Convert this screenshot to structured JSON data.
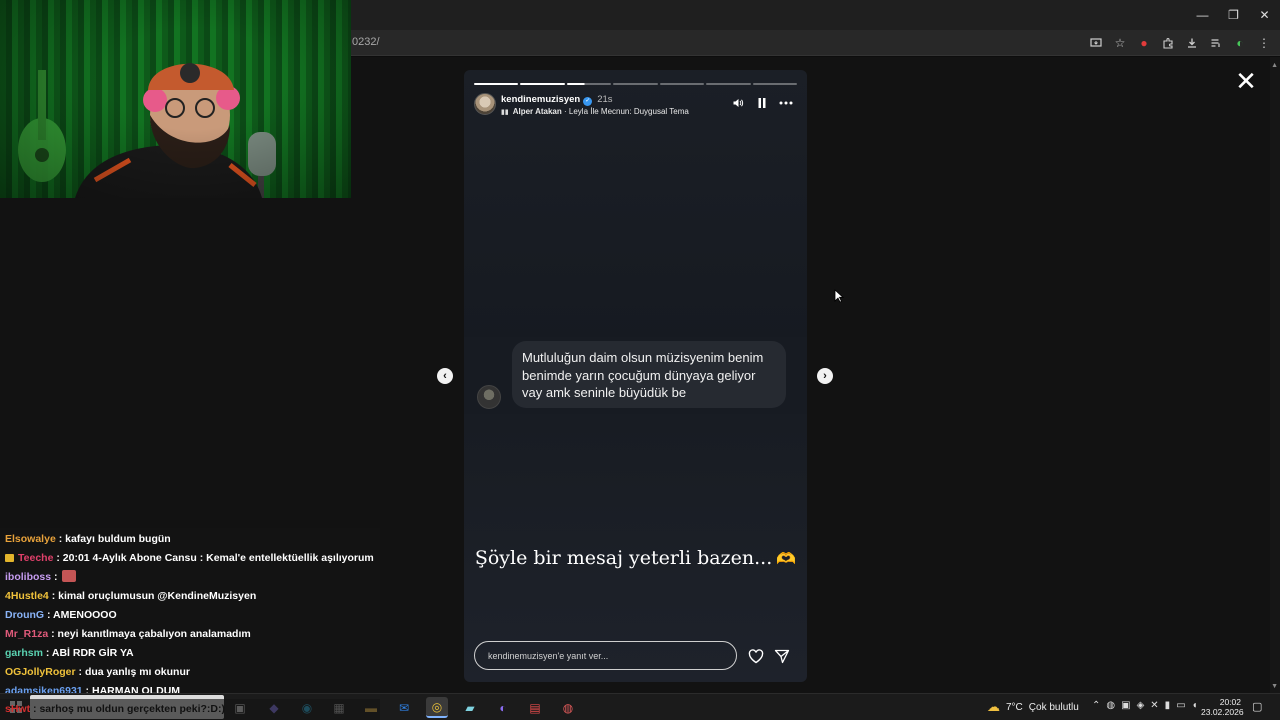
{
  "browser": {
    "url_fragment": "0232/",
    "window_controls": [
      "—",
      "❐",
      "✕"
    ]
  },
  "story": {
    "username": "kendinemuzisyen",
    "time_ago": "21s",
    "music_artist": "Alper Atakan",
    "music_separator": " · ",
    "music_title": "Leyla İle Mecnun: Duygusal Tema",
    "progress": {
      "segments": 7,
      "completed": 2,
      "current_fraction": 0.4
    },
    "comment_text": "Mutluluğun daim olsun müzisyenim benim benimde yarın çocuğum dünyaya geliyor vay amk seninle büyüdük be",
    "caption": "Şöyle bir mesaj yeterli bazen...",
    "caption_emoji": "🫶",
    "reply_placeholder": "kendinemuzisyen'e yanıt ver..."
  },
  "chat": {
    "messages": [
      {
        "user": "Elsowalye",
        "color": "#e8a23b",
        "sep": " : ",
        "text": "kafayı buldum bugün"
      },
      {
        "user": "Teeche",
        "color": "#e0406a",
        "badge": true,
        "sep": " : ",
        "text": "20:01 4-Aylık Abone Cansu : Kemal'e entellektüellik aşılıyorum"
      },
      {
        "user": "iboliboss",
        "color": "#c69cf0",
        "sep": " : ",
        "text": "",
        "emote": true
      },
      {
        "user": "4Hustle4",
        "color": "#f0c23b",
        "sep": " : ",
        "text": "kimal oruçlumusun @KendineMuzisyen"
      },
      {
        "user": "DrounG",
        "color": "#8ab4f8",
        "sep": " : ",
        "text": "AMENOOOO"
      },
      {
        "user": "Mr_R1za",
        "color": "#e05a7a",
        "sep": " : ",
        "text": "neyi kanıtlmaya çabalıyon analamadım"
      },
      {
        "user": "garhsm",
        "color": "#5ad1b0",
        "sep": " : ",
        "text": "ABİ RDR GİR YA"
      },
      {
        "user": "OGJollyRoger",
        "color": "#f0c23b",
        "sep": " : ",
        "text": "dua yanlış mı okunur"
      },
      {
        "user": "adamsiken6931",
        "color": "#6aa0f0",
        "sep": " : ",
        "text": "HARMAN OLDUM"
      }
    ],
    "last_partial": {
      "user": "sHwt",
      "sep": " : ",
      "text": "sarhoş mu oldun gerçekten peki?:D:)"
    }
  },
  "taskbar": {
    "weather_temp": "7°C",
    "weather_desc": "Çok bulutlu",
    "time": "20:02",
    "date": "23.02.2026"
  },
  "colors": {
    "story_bg": "#1b1f26",
    "bubble_bg": "#262a31",
    "verified": "#3897f0",
    "accent_red": "#e23b3b"
  }
}
